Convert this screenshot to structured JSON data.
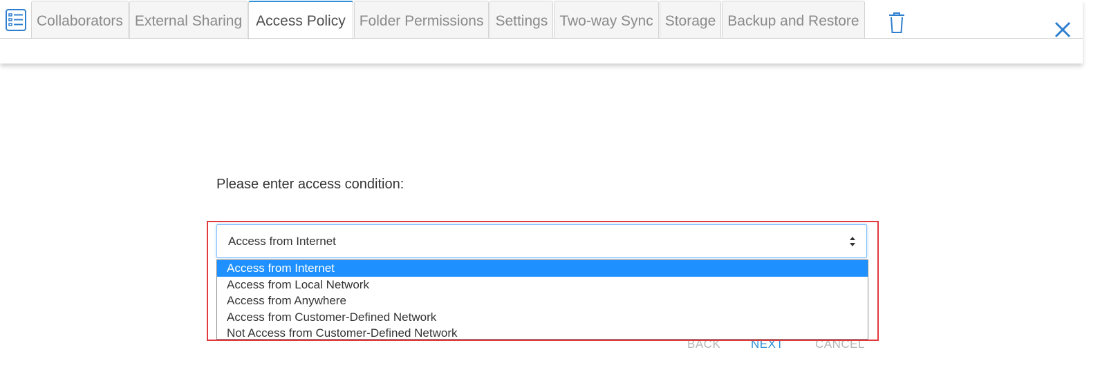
{
  "tabs": [
    {
      "label": "Collaborators",
      "active": false
    },
    {
      "label": "External Sharing",
      "active": false
    },
    {
      "label": "Access Policy",
      "active": true
    },
    {
      "label": "Folder Permissions",
      "active": false
    },
    {
      "label": "Settings",
      "active": false
    },
    {
      "label": "Two-way Sync",
      "active": false
    },
    {
      "label": "Storage",
      "active": false
    },
    {
      "label": "Backup and Restore",
      "active": false
    }
  ],
  "icons": {
    "list": "list-icon",
    "trash": "trash-icon",
    "close": "close-icon",
    "select_arrows": "sort-arrows-icon"
  },
  "form": {
    "prompt": "Please enter access condition:",
    "select_value": "Access from Internet",
    "options": [
      "Access from Internet",
      "Access from Local Network",
      "Access from Anywhere",
      "Access from Customer-Defined Network",
      "Not Access from Customer-Defined Network"
    ],
    "selected_index": 0
  },
  "buttons": {
    "back": "BACK",
    "next": "NEXT",
    "cancel": "CANCEL"
  },
  "colors": {
    "accent": "#2f8fd8",
    "selection": "#1e90ff",
    "highlight_border": "#e0393e"
  }
}
